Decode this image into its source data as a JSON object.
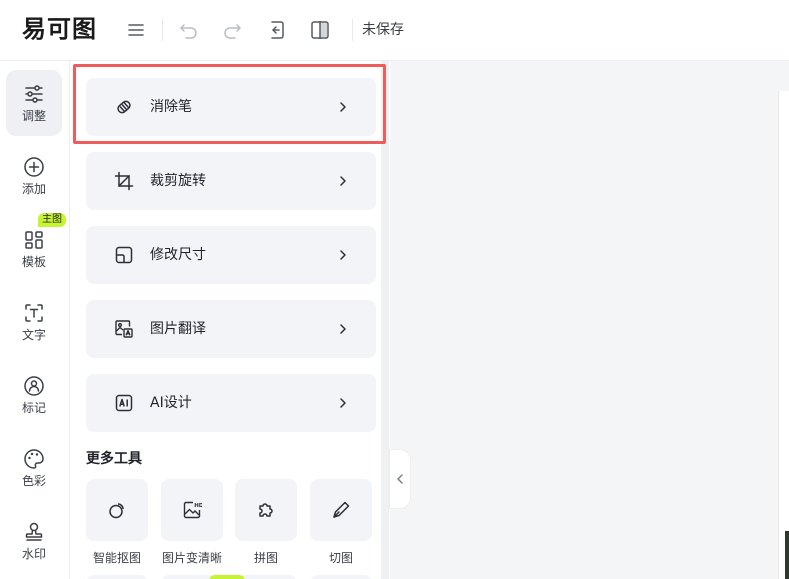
{
  "app": {
    "logo_text": "易可图",
    "status": "未保存"
  },
  "toolbar": {
    "icons": [
      "menu-icon",
      "undo-icon",
      "redo-icon",
      "history-icon",
      "compare-icon"
    ]
  },
  "leftnav": {
    "items": [
      {
        "label": "调整",
        "icon": "sliders-icon",
        "active": true
      },
      {
        "label": "添加",
        "icon": "plus-circle-icon"
      },
      {
        "label": "模板",
        "icon": "template-grid-icon",
        "badge": "主图"
      },
      {
        "label": "文字",
        "icon": "text-icon"
      },
      {
        "label": "标记",
        "icon": "mark-icon"
      },
      {
        "label": "色彩",
        "icon": "palette-icon"
      },
      {
        "label": "水印",
        "icon": "stamp-icon"
      }
    ]
  },
  "panel": {
    "tools": [
      {
        "label": "消除笔",
        "icon": "eraser-icon"
      },
      {
        "label": "裁剪旋转",
        "icon": "crop-icon"
      },
      {
        "label": "修改尺寸",
        "icon": "resize-icon"
      },
      {
        "label": "图片翻译",
        "icon": "image-translate-icon"
      },
      {
        "label": "AI设计",
        "icon": "ai-icon"
      }
    ],
    "more_title": "更多工具",
    "more_tools": [
      {
        "label": "智能抠图",
        "icon": "cutout-icon"
      },
      {
        "label": "图片变清晰",
        "icon": "hd-icon"
      },
      {
        "label": "拼图",
        "icon": "puzzle-icon"
      },
      {
        "label": "切图",
        "icon": "slice-icon"
      }
    ]
  },
  "colors": {
    "highlight": "#ef5d5a",
    "badge": "#c6f432",
    "card_bg": "#f2f4f8"
  }
}
